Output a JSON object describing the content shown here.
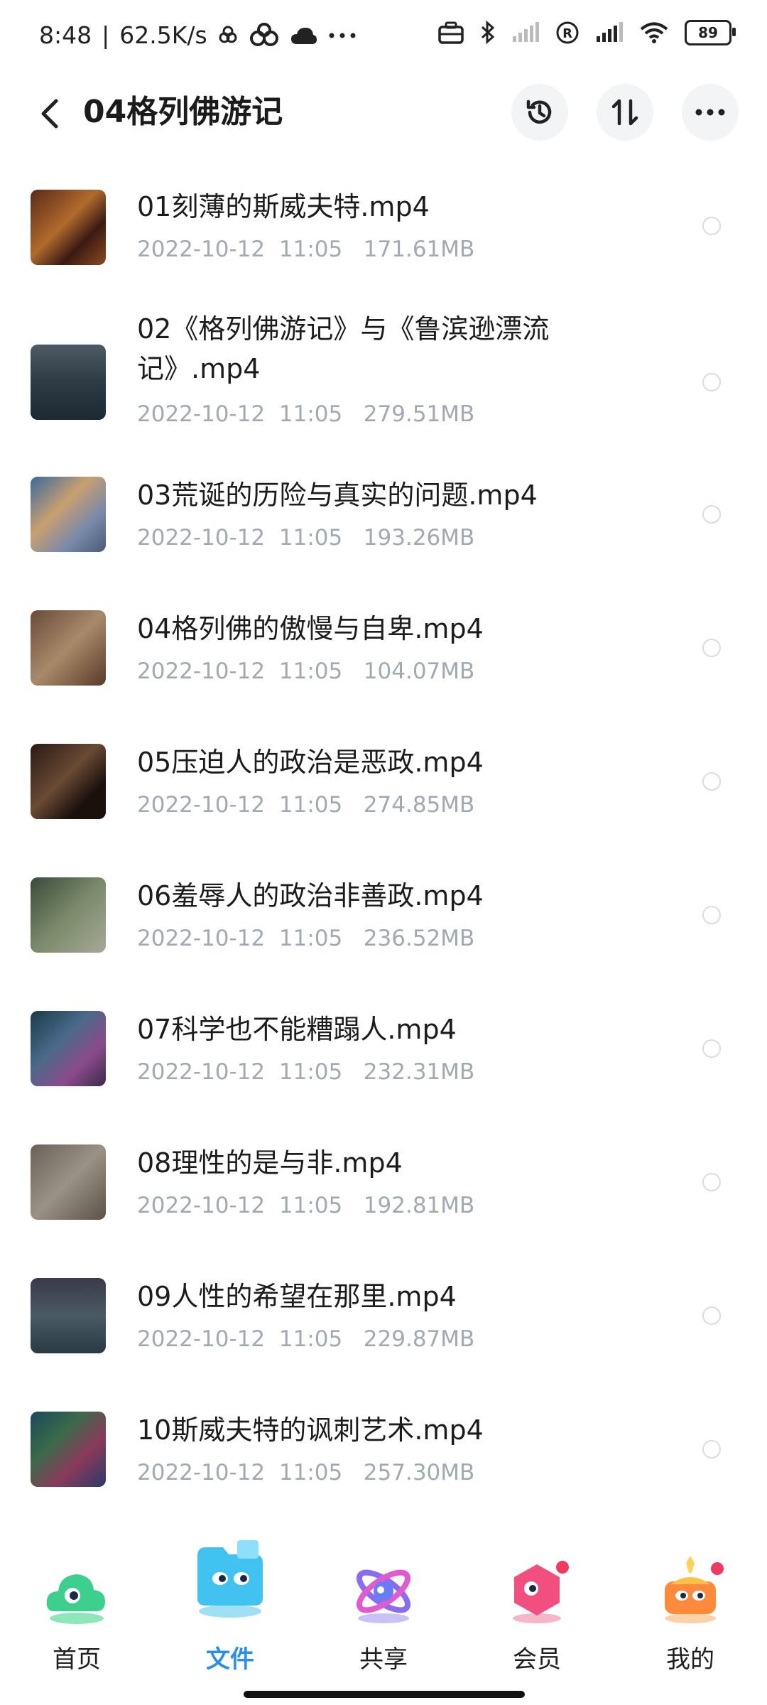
{
  "status_bar": {
    "time": "8:48",
    "speed": "62.5K/s",
    "battery": "89"
  },
  "header": {
    "title": "04格列佛游记",
    "icons": [
      "back-icon",
      "history-icon",
      "sort-icon",
      "more-icon"
    ]
  },
  "files": [
    {
      "name": "01刻薄的斯威夫特.mp4",
      "date": "2022-10-12",
      "time": "11:05",
      "size": "171.61MB"
    },
    {
      "name": "02《格列佛游记》与《鲁滨逊漂流记》.mp4",
      "date": "2022-10-12",
      "time": "11:05",
      "size": "279.51MB"
    },
    {
      "name": "03荒诞的历险与真实的问题.mp4",
      "date": "2022-10-12",
      "time": "11:05",
      "size": "193.26MB"
    },
    {
      "name": "04格列佛的傲慢与自卑.mp4",
      "date": "2022-10-12",
      "time": "11:05",
      "size": "104.07MB"
    },
    {
      "name": "05压迫人的政治是恶政.mp4",
      "date": "2022-10-12",
      "time": "11:05",
      "size": "274.85MB"
    },
    {
      "name": "06羞辱人的政治非善政.mp4",
      "date": "2022-10-12",
      "time": "11:05",
      "size": "236.52MB"
    },
    {
      "name": "07科学也不能糟蹋人.mp4",
      "date": "2022-10-12",
      "time": "11:05",
      "size": "232.31MB"
    },
    {
      "name": "08理性的是与非.mp4",
      "date": "2022-10-12",
      "time": "11:05",
      "size": "192.81MB"
    },
    {
      "name": "09人性的希望在那里.mp4",
      "date": "2022-10-12",
      "time": "11:05",
      "size": "229.87MB"
    },
    {
      "name": "10斯威夫特的讽刺艺术.mp4",
      "date": "2022-10-12",
      "time": "11:05",
      "size": "257.30MB"
    }
  ],
  "nav": [
    {
      "label": "首页",
      "icon": "home-cloud-icon",
      "active": false
    },
    {
      "label": "文件",
      "icon": "files-folder-icon",
      "active": true
    },
    {
      "label": "共享",
      "icon": "share-atom-icon",
      "active": false
    },
    {
      "label": "会员",
      "icon": "member-icon",
      "active": false
    },
    {
      "label": "我的",
      "icon": "profile-icon",
      "active": false
    }
  ],
  "colors": {
    "accent": "#2b8fe6",
    "meta_text": "#a3a9b3",
    "header_button_bg": "#f3f4f6"
  }
}
